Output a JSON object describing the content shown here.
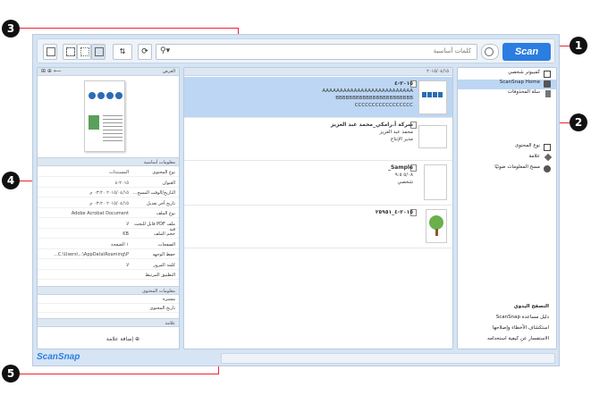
{
  "toolbar": {
    "search_placeholder": "كلمات أساسية",
    "scan_label": "Scan"
  },
  "left_panel": {
    "header": "العرض",
    "basic_section": "معلومات أساسية",
    "rows": [
      {
        "label": "نوع المحتوى",
        "value": "المستندات"
      },
      {
        "label": "العنوان",
        "value": "٢٠١٥-٤"
      },
      {
        "label": "التاريخ/الوقت المسح...",
        "value": "٢٠١٥/٠٤/١٥ ٠٣:٢٠ م"
      },
      {
        "label": "تاريخ آخر تعديل",
        "value": "٢٠١٥/٠٤/١٥ ٠٣:٢٠ م"
      },
      {
        "label": "نوع الملف",
        "value": "Adobe Acrobat Document"
      },
      {
        "label": "ملف PDF قابل للبحث فيه",
        "value": "لا"
      },
      {
        "label": "حجم الملف",
        "value": "KB"
      },
      {
        "label": "الصفحات",
        "value": "١ الصفحة"
      },
      {
        "label": "حفظ الوجهة",
        "value": "C:\\Users\\...\\AppData\\Roaming\\P..."
      },
      {
        "label": "كلمة المرور",
        "value": "لا"
      },
      {
        "label": "التطبيق المرتبط",
        "value": ""
      }
    ],
    "content_section": "معلومات المحتوى",
    "content_rows": [
      {
        "label": "مشترة",
        "value": ""
      },
      {
        "label": "تاريخ المحتوى",
        "value": ""
      }
    ],
    "tag_section": "علامة",
    "add_tag": "إضافة علامة"
  },
  "middle_panel": {
    "header": "٢٠١٥/٠٤/١٥",
    "items": [
      {
        "name": "٢٠١٥-٤",
        "lines": [
          "AAAAAAAAAAAAAAAAAAAAAAAAAA",
          "BBBBBBBBBBBBBBBBBBBBBBB",
          "CCCCCCCCCCCCCCCCC"
        ],
        "selected": true
      },
      {
        "name": "شركة أ.رامكي_محمد عبد العزيز",
        "lines": [
          "محمد عبد العزيز",
          "مدير الإنتاج"
        ],
        "selected": false
      },
      {
        "name": "Sample_",
        "lines": [
          "٥/٠٨ ٩:٥",
          "شخصي"
        ],
        "selected": false
      },
      {
        "name": "٢٠١٥-٤_٢٥٩٥١",
        "lines": [],
        "selected": false
      }
    ]
  },
  "right_panel": {
    "nav": [
      {
        "label": "كمبيوتر شخصي",
        "icon": "computer-icon"
      },
      {
        "label": "ScanSnap Home",
        "icon": "home-icon"
      },
      {
        "label": "سلة المحذوفات",
        "icon": "trash-icon"
      },
      {
        "label": "نوع المحتوى",
        "icon": "document-type-icon"
      },
      {
        "label": "علامة",
        "icon": "tag-icon"
      },
      {
        "label": "مسح المعلومات ضوئيًا",
        "icon": "scan-info-icon"
      }
    ],
    "help_title": "التصفح اليدوي",
    "help_links": [
      "دليل مساعدة ScanSnap",
      "استكشاف الأخطاء وإصلاحها",
      "الاستفسار عن كيفية استخدامه"
    ]
  },
  "footer": {
    "brand": "ScanSnap"
  },
  "callouts": [
    "1",
    "2",
    "3",
    "4",
    "5"
  ],
  "colors": {
    "accent": "#2b7de1",
    "selection": "#bcd6f4",
    "panel_header": "#dde7f2"
  }
}
